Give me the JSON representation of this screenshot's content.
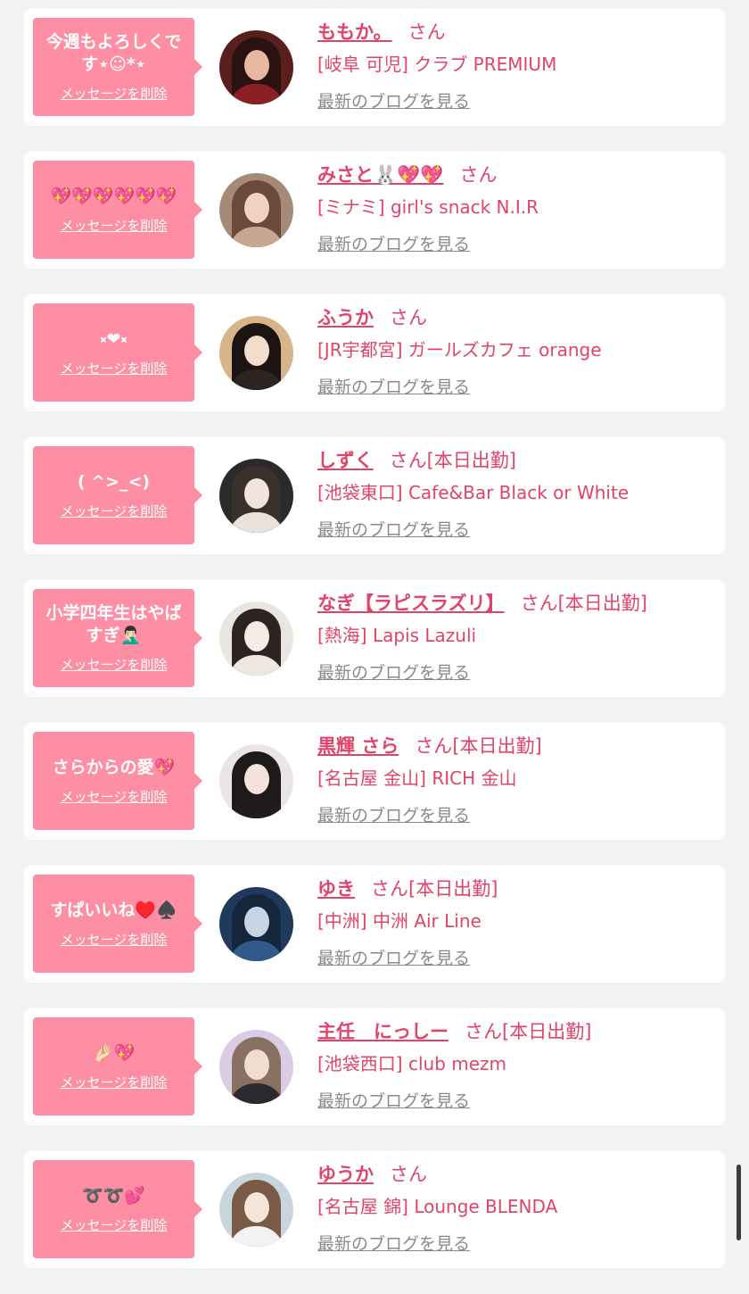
{
  "delete_label": "メッセージを削除",
  "blog_label": "最新のブログを見る",
  "san_label": "さん",
  "cards": [
    {
      "message": "今週もよろしくで\nす⋆☺︎*⋆",
      "name": "ももか。",
      "duty": "",
      "shop": "[岐阜 可児] クラブ PREMIUM",
      "avatar": {
        "bg": "#5a1e1c",
        "hair": "#2a1210",
        "skin": "#e8b9a0",
        "body": "#8a1f24"
      }
    },
    {
      "message": "💖💖💖💖💖💖",
      "name": "みさと🐰💖💖",
      "duty": "",
      "shop": "[ミナミ] girl's snack N.I.R",
      "avatar": {
        "bg": "#a58a78",
        "hair": "#6b4a3a",
        "skin": "#f0d2c0",
        "body": "#c9a692"
      }
    },
    {
      "message": "༝❤︎༝",
      "name": "ふうか",
      "duty": "",
      "shop": "[JR宇都宮] ガールズカフェ orange",
      "avatar": {
        "bg": "#d8b48a",
        "hair": "#1c1412",
        "skin": "#f3dccc",
        "body": "#2b2422"
      }
    },
    {
      "message": "( ^>_<)",
      "name": "しずく",
      "duty": "[本日出勤]",
      "shop": "[池袋東口] Cafe&Bar Black or White",
      "avatar": {
        "bg": "#2a2a2a",
        "hair": "#3a302c",
        "skin": "#f1e4dc",
        "body": "#e9e2dc"
      }
    },
    {
      "message": "小学四年生はやば\nすぎ🤦🏻‍♂️",
      "name": "なぎ【ラピスラズリ】",
      "duty": "[本日出勤]",
      "shop": "[熱海] Lapis Lazuli",
      "avatar": {
        "bg": "#e9e6e2",
        "hair": "#2d2320",
        "skin": "#f5ebe5",
        "body": "#ede7df"
      }
    },
    {
      "message": "さらからの愛💖",
      "name": "黒輝 さら",
      "duty": "[本日出勤]",
      "shop": "[名古屋 金山] RICH 金山",
      "avatar": {
        "bg": "#ebe4e4",
        "hair": "#1e1a1c",
        "skin": "#f4e3dc",
        "body": "#201c1e"
      }
    },
    {
      "message": "すぱいいね♥️♠️",
      "name": "ゆき",
      "duty": "[本日出勤]",
      "shop": "[中洲] 中洲 Air Line",
      "avatar": {
        "bg": "#1f3a5c",
        "hair": "#16263c",
        "skin": "#c7d4e4",
        "body": "#2f5a8a"
      }
    },
    {
      "message": "🤌🏻💖",
      "name": "主任　にっしー",
      "duty": "[本日出勤]",
      "shop": "[池袋西口] club mezm",
      "avatar": {
        "bg": "#d9cce4",
        "hair": "#8a7060",
        "skin": "#f0ddd0",
        "body": "#2a2a2e"
      }
    },
    {
      "message": "➰➰💕",
      "name": "ゆうか",
      "duty": "",
      "shop": "[名古屋 錦] Lounge BLENDA",
      "avatar": {
        "bg": "#c9d5dc",
        "hair": "#7a5a44",
        "skin": "#f6e4d8",
        "body": "#f2f2f2"
      }
    }
  ]
}
